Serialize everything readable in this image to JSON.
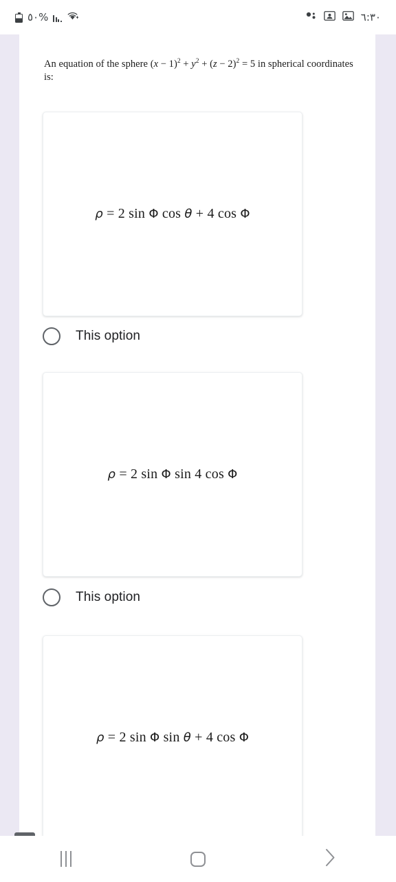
{
  "status_bar": {
    "battery_icon": "battery-icon",
    "battery_percent": "٥٠%",
    "signal_icon": "signal-bars-icon",
    "wifi_icon": "wifi-icon",
    "notification_dots_icon": "notification-dots-icon",
    "contacts_icon": "contacts-icon",
    "photo_icon": "photo-icon",
    "time": "٦:٣٠"
  },
  "question": {
    "prefix": "An equation of the sphere (",
    "expr_x": "x",
    "expr_mid1": " − 1)",
    "sup1": "2",
    "expr_plus1": " + ",
    "expr_y": "y",
    "sup2": "2",
    "expr_plus2": " + (",
    "expr_z": "z",
    "expr_mid2": " − 2)",
    "sup3": "2",
    "expr_eq": " = 5  in spherical coordinates is:",
    "full_text": "An equation of the sphere (x − 1)² + y² + (z − 2)² = 5  in spherical coordinates is:"
  },
  "options": [
    {
      "rho": "ρ",
      "equals": " = 2 sin ",
      "phi1": "Φ",
      "fn": " cos ",
      "theta": "θ",
      "tail": " + 4 cos ",
      "phi2": "Φ",
      "formula_text": "ρ = 2 sin Φ cos θ + 4 cos Φ",
      "radio_label": "This option",
      "selected": false
    },
    {
      "rho": "ρ",
      "equals": " = 2 sin ",
      "phi1": "Φ",
      "fn": " sin ",
      "theta": "4",
      "tail": " cos ",
      "phi2": "Φ",
      "formula_text": "ρ = 2 sin Φ sin  4 cos Φ",
      "radio_label": "This option",
      "selected": false
    },
    {
      "rho": "ρ",
      "equals": " = 2 sin ",
      "phi1": "Φ",
      "fn": " sin ",
      "theta": "θ",
      "tail": " + 4 cos ",
      "phi2": "Φ",
      "formula_text": "ρ = 2 sin Φ sin θ + 4 cos Φ",
      "radio_label": "",
      "selected": false
    }
  ],
  "warning_badge": {
    "icon": "warning-exclamation-icon"
  },
  "nav_bar": {
    "recents_icon": "recents-icon",
    "home_icon": "home-icon",
    "back_icon": "back-chevron-icon"
  },
  "colors": {
    "page_background": "#ebe8f3",
    "content_background": "#ffffff",
    "text_primary": "#1b1b1b",
    "radio_stroke": "#5f6368",
    "nav_icon": "#8e9094",
    "card_border": "#eceff1"
  }
}
